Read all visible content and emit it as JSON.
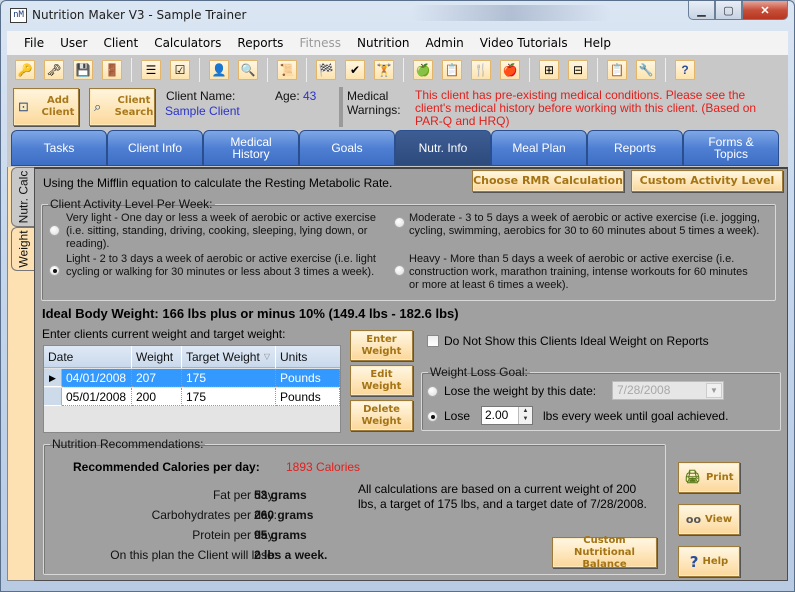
{
  "window": {
    "title": "Nutrition Maker V3 - Sample Trainer",
    "app_icon": "nM",
    "controls": [
      "minimize",
      "maximize",
      "close"
    ]
  },
  "menu": {
    "items": [
      {
        "label": "File",
        "disabled": false
      },
      {
        "label": "User",
        "disabled": false
      },
      {
        "label": "Client",
        "disabled": false
      },
      {
        "label": "Calculators",
        "disabled": false
      },
      {
        "label": "Reports",
        "disabled": false
      },
      {
        "label": "Fitness",
        "disabled": true
      },
      {
        "label": "Nutrition",
        "disabled": false
      },
      {
        "label": "Admin",
        "disabled": false
      },
      {
        "label": "Video Tutorials",
        "disabled": false
      },
      {
        "label": "Help",
        "disabled": false
      }
    ]
  },
  "toolbar": {
    "groups": [
      [
        {
          "icon": "login-key-icon",
          "glyph": "🔑"
        },
        {
          "icon": "logout-key-icon",
          "glyph": "🗝"
        },
        {
          "icon": "save-icon",
          "glyph": "💾"
        },
        {
          "icon": "exit-door-icon",
          "glyph": "🚪"
        }
      ],
      [
        {
          "icon": "checklist-icon",
          "glyph": "☰"
        },
        {
          "icon": "notes-icon",
          "glyph": "☑"
        }
      ],
      [
        {
          "icon": "add-client-icon",
          "glyph": "👤"
        },
        {
          "icon": "search-icon",
          "glyph": "🔍"
        }
      ],
      [
        {
          "icon": "scroll-icon",
          "glyph": "📜"
        }
      ],
      [
        {
          "icon": "checkered-flag-icon",
          "glyph": "🏁"
        },
        {
          "icon": "checked-doc-icon",
          "glyph": "✔"
        },
        {
          "icon": "weightlifter-icon",
          "glyph": "🏋"
        }
      ],
      [
        {
          "icon": "apple-icon",
          "glyph": "🍏"
        },
        {
          "icon": "food-log-icon",
          "glyph": "📋"
        },
        {
          "icon": "fork-icon",
          "glyph": "🍴"
        },
        {
          "icon": "red-apple-icon",
          "glyph": "🍎"
        }
      ],
      [
        {
          "icon": "add-page-icon",
          "glyph": "⊞"
        },
        {
          "icon": "add-list-icon",
          "glyph": "⊟"
        }
      ],
      [
        {
          "icon": "clipboard-icon",
          "glyph": "📋"
        },
        {
          "icon": "tools-icon",
          "glyph": "🔧"
        }
      ],
      [
        {
          "icon": "help-icon",
          "glyph": "?"
        }
      ]
    ]
  },
  "client_bar": {
    "add_client": "Add Client",
    "client_search": "Client Search",
    "client_name_label": "Client Name:",
    "client_name": "Sample Client",
    "age_label": "Age:",
    "age": "43",
    "medical_warnings_label": "Medical Warnings:",
    "medical_warnings": "This client has pre-existing medical conditions. Please see the client's medical history before working with this client.  (Based on PAR-Q and HRQ)"
  },
  "tabs": [
    {
      "label": "Tasks",
      "active": false
    },
    {
      "label": "Client Info",
      "active": false
    },
    {
      "label": "Medical History",
      "active": false
    },
    {
      "label": "Goals",
      "active": false
    },
    {
      "label": "Nutr. Info",
      "active": true
    },
    {
      "label": "Meal Plan",
      "active": false
    },
    {
      "label": "Reports",
      "active": false
    },
    {
      "label": "Forms & Topics",
      "active": false
    }
  ],
  "side_tabs": [
    {
      "label": "Nutr. Calc",
      "active": false
    },
    {
      "label": "Weight",
      "active": true
    }
  ],
  "nutr": {
    "intro": "Using the Mifflin equation to calculate the Resting Metabolic Rate.",
    "choose_rmr": "Choose RMR Calculation",
    "custom_activity": "Custom Activity Level",
    "activity_legend": "Client Activity Level Per Week:",
    "activity_options": [
      {
        "label": "Very light - One day or less a week of aerobic or active exercise (i.e. sitting, standing, driving, cooking, sleeping, lying down, or reading).",
        "selected": false
      },
      {
        "label": "Light - 2 to 3 days a week of aerobic or active exercise (i.e. light cycling or walking for 30 minutes or less about 3 times a week).",
        "selected": true
      },
      {
        "label": "Moderate - 3 to 5 days a week of aerobic or active exercise (i.e. jogging, cycling, swimming, aerobics for 30 to 60 minutes about 5 times a week).",
        "selected": false
      },
      {
        "label": "Heavy - More than 5 days a week of aerobic or active exercise (i.e. construction work, marathon training, intense workouts for 60 minutes or more at least 6 times a week).",
        "selected": false
      }
    ],
    "ideal_weight": "Ideal Body Weight: 166 lbs plus or minus 10% (149.4 lbs - 182.6 lbs)",
    "enter_prompt": "Enter clients current weight and target weight:",
    "grid": {
      "columns": [
        "Date",
        "Weight",
        "Target Weight",
        "Units"
      ],
      "rows": [
        {
          "date": "04/01/2008",
          "weight": "207",
          "target": "175",
          "units": "Pounds",
          "selected": true
        },
        {
          "date": "05/01/2008",
          "weight": "200",
          "target": "175",
          "units": "Pounds",
          "selected": false
        }
      ]
    },
    "enter_weight": "Enter Weight",
    "edit_weight": "Edit Weight",
    "delete_weight": "Delete Weight",
    "hide_ideal_label": "Do Not Show this Clients Ideal Weight on Reports",
    "hide_ideal_checked": false,
    "weight_loss_legend": "Weight Loss Goal:",
    "by_date_label": "Lose the weight by this date:",
    "by_date_value": "7/28/2008",
    "by_date_selected": false,
    "lose_label": "Lose",
    "lose_value": "2.00",
    "lose_selected": true,
    "lose_suffix": "lbs every week until goal achieved.",
    "recommendations": {
      "legend": "Nutrition Recommendations:",
      "calories_label": "Recommended Calories per day:",
      "calories_value": "1893 Calories",
      "calories_color": "#e0201c",
      "rows": [
        {
          "label": "Fat per day:",
          "value": "53 grams"
        },
        {
          "label": "Carbohydrates  per day:",
          "value": "260 grams"
        },
        {
          "label": "Protein per day:",
          "value": "95 grams"
        },
        {
          "label": "On this plan the Client will lose:",
          "value": "2 lbs a week."
        }
      ],
      "note": "All calculations are based on a current weight of 200 lbs, a target of 175 lbs, and a target date of 7/28/2008.",
      "custom_balance": "Custom Nutritional Balance"
    },
    "print": "Print",
    "view": "View",
    "help": "Help"
  }
}
